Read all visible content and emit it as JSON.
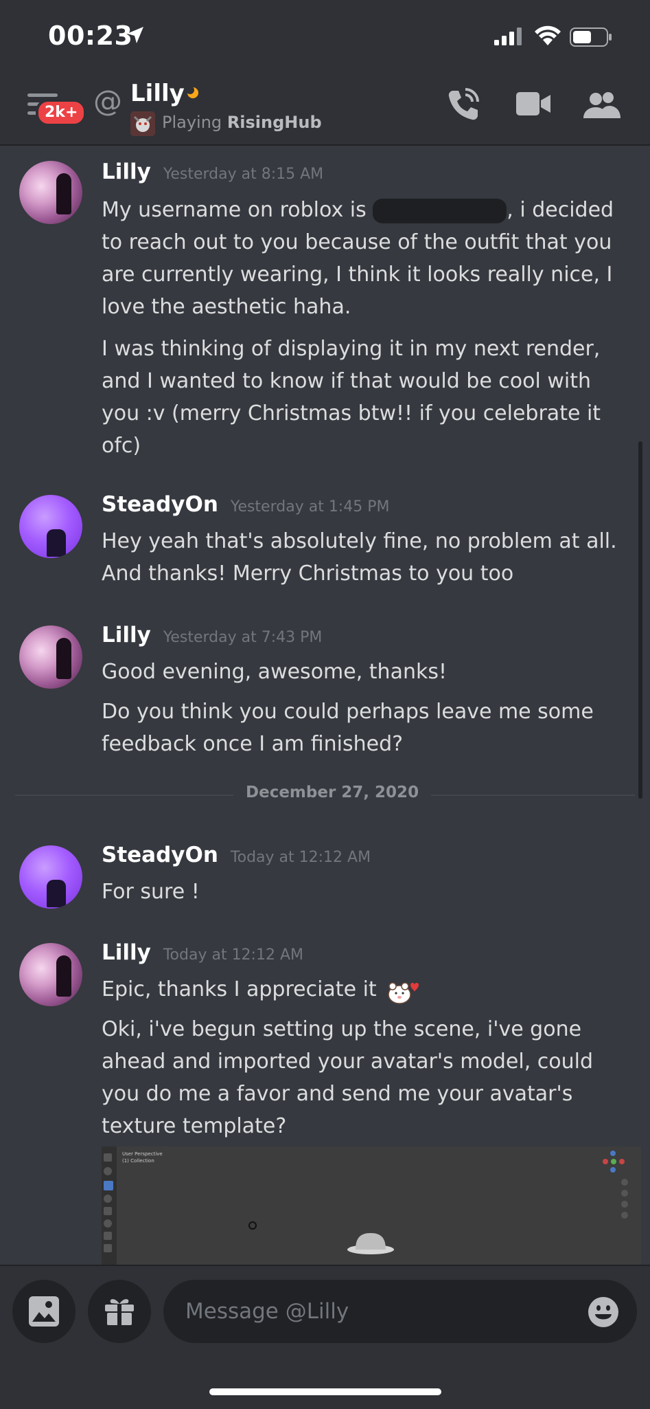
{
  "status_bar": {
    "time": "00:23"
  },
  "header": {
    "badge": "2k+",
    "at_symbol": "@",
    "name": "Lilly",
    "activity_prefix": "Playing",
    "activity_game": "RisingHub"
  },
  "messages": [
    {
      "author": "Lilly",
      "timestamp": "Yesterday at 8:15 AM",
      "lines": [
        {
          "before_redaction": "My username on roblox is",
          "after_redaction": ", i decided to reach out to you because of the outfit that you are currently wearing, I think it looks really nice, I love the aesthetic haha."
        },
        {
          "text": "I was thinking of displaying it in my next render, and I wanted to know if that would be cool with you :v  (merry Christmas btw!! if you celebrate it ofc)"
        }
      ]
    },
    {
      "author": "SteadyOn",
      "timestamp": "Yesterday at 1:45 PM",
      "lines": [
        {
          "text": "Hey yeah that's absolutely fine, no problem at all. And thanks! Merry Christmas to you too"
        }
      ]
    },
    {
      "author": "Lilly",
      "timestamp": "Yesterday at 7:43 PM",
      "lines": [
        {
          "text": "Good evening, awesome, thanks!"
        },
        {
          "text": "Do you think you could perhaps leave me some feedback once I am finished?"
        }
      ]
    },
    {
      "author": "SteadyOn",
      "timestamp": "Today at 12:12 AM",
      "lines": [
        {
          "text": "For sure !"
        }
      ]
    },
    {
      "author": "Lilly",
      "timestamp": "Today at 12:12 AM",
      "lines": [
        {
          "text": "Epic, thanks I appreciate it"
        },
        {
          "text": "Oki, i've begun setting up the scene, i've gone ahead and imported your avatar's model, could you do me a favor and send me your avatar's texture template?"
        }
      ]
    }
  ],
  "divider": "December 27, 2020",
  "attachment": {
    "viewport_label": "User Perspective",
    "collection_label": "(1) Collection"
  },
  "composer": {
    "placeholder": "Message @Lilly"
  },
  "icons": {
    "menu": "menu-icon",
    "location": "location-arrow-icon",
    "signal": "signal-icon",
    "wifi": "wifi-icon",
    "battery": "battery-icon",
    "at": "at-icon",
    "moon": "idle-moon-icon",
    "call": "phone-call-icon",
    "video": "video-camera-icon",
    "members": "members-icon",
    "image": "image-icon",
    "gift": "gift-icon",
    "emoji": "emoji-icon",
    "sticker": "bear-heart-sticker"
  },
  "colors": {
    "background": "#36393f",
    "header": "#2f3136",
    "input": "#202225",
    "badge": "#ed4245",
    "idle": "#faa61a",
    "text": "#dcddde",
    "muted": "#72767d"
  }
}
